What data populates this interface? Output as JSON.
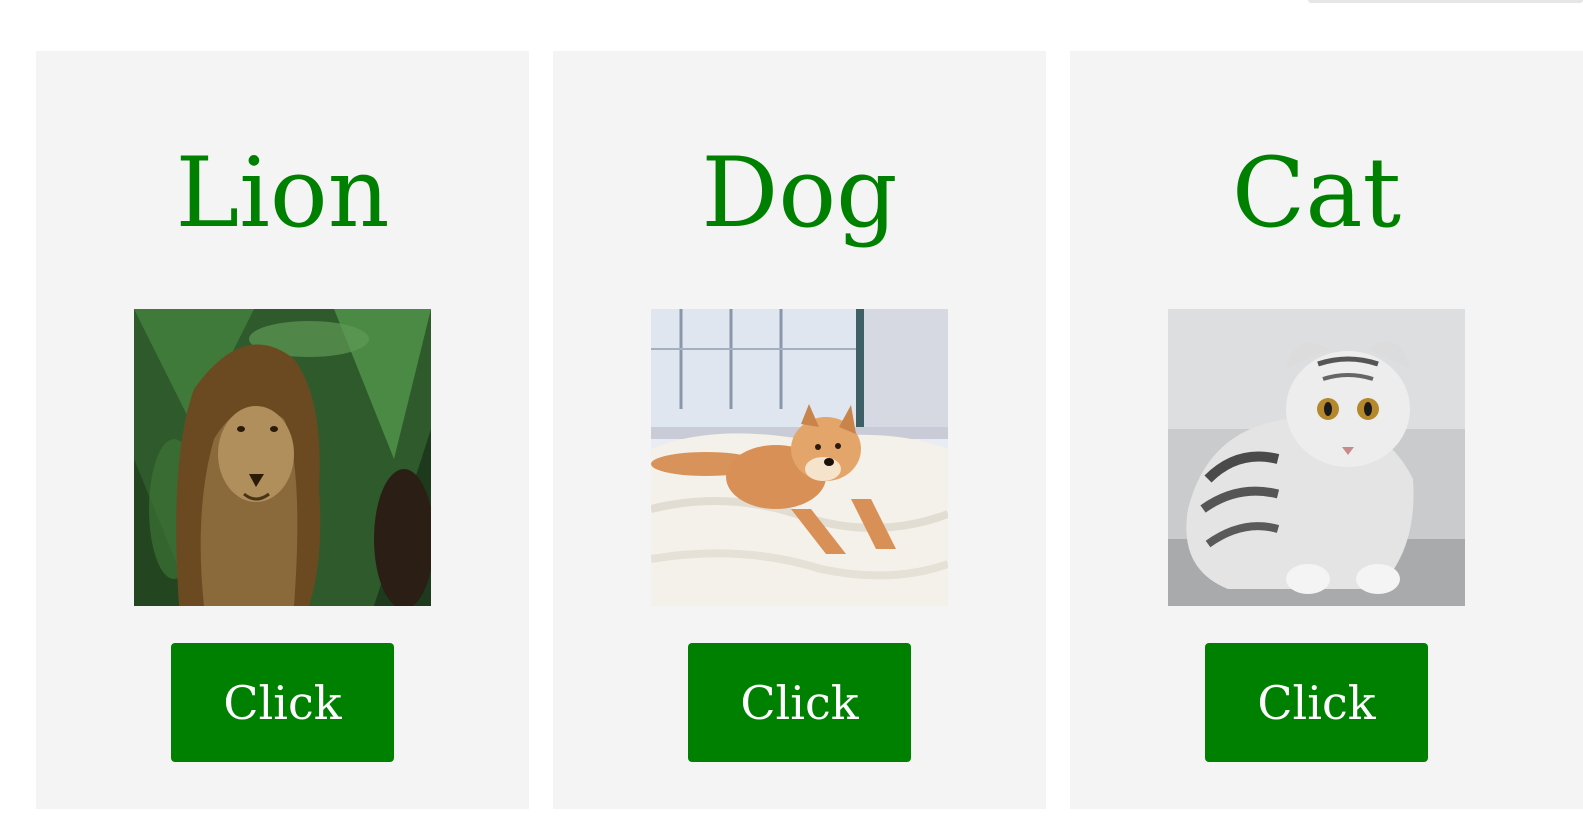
{
  "cards": [
    {
      "title": "Lion",
      "image": "lion-photo",
      "button_label": "Click"
    },
    {
      "title": "Dog",
      "image": "dog-photo",
      "button_label": "Click"
    },
    {
      "title": "Cat",
      "image": "cat-photo",
      "button_label": "Click"
    }
  ],
  "colors": {
    "accent": "#008000",
    "card_background": "#f4f4f4",
    "page_background": "#ffffff",
    "button_text": "#ffffff"
  }
}
